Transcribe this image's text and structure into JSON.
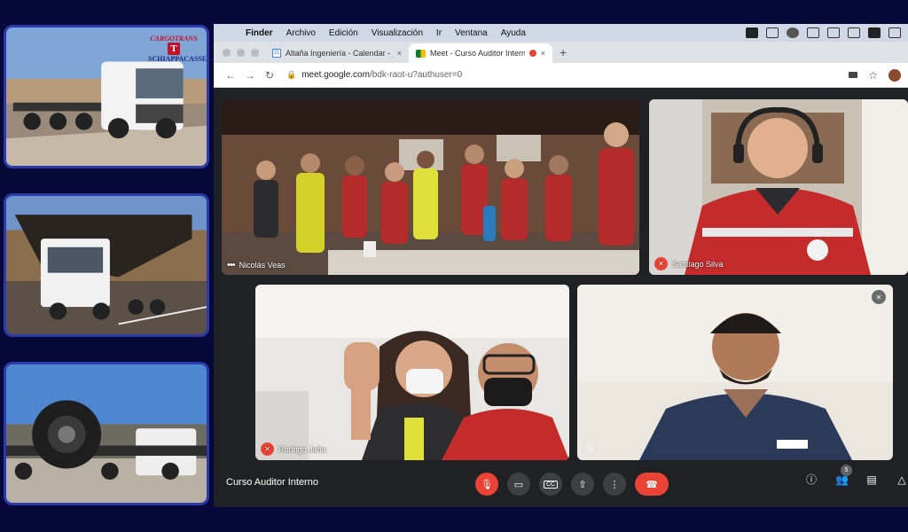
{
  "side_photos": {
    "logo": {
      "top": "CARGOTRANS",
      "mark": "T",
      "bottom": "SCHIAPPACASSE"
    },
    "items": [
      {
        "name": "flatbed-truck"
      },
      {
        "name": "mining-truck-bed-transport"
      },
      {
        "name": "giant-tire-transport"
      }
    ]
  },
  "menubar": {
    "apple": "",
    "items": [
      "Finder",
      "Archivo",
      "Edición",
      "Visualización",
      "Ir",
      "Ventana",
      "Ayuda"
    ]
  },
  "browser": {
    "tabs": [
      {
        "title": "Altaña Ingeniería - Calendar - j",
        "close": "×",
        "fav": "31"
      },
      {
        "title": "Meet - Curso Auditor Intern",
        "close": "×"
      }
    ],
    "new_tab": "+",
    "nav": {
      "back": "←",
      "forward": "→",
      "reload": "↻"
    },
    "lock": "🔒",
    "url_host": "meet.google.com",
    "url_path": "/bdk-raot-u?authuser=0",
    "star": "☆"
  },
  "meet": {
    "tiles": [
      {
        "name": "Nicolás Veas",
        "muted": false
      },
      {
        "name": "Santiago Silva",
        "muted": true
      },
      {
        "name": "Rodrigo Jaña",
        "muted": true
      },
      {
        "name": "",
        "muted": true,
        "corner_badge": "16"
      }
    ],
    "meeting_name": "Curso Auditor Interno",
    "controls": {
      "mic": "🎙",
      "camera": "▭",
      "captions": "CC",
      "present": "⇧",
      "more": "⋮",
      "end": "☎"
    },
    "right_controls": {
      "info": "ⓘ",
      "people": "👥",
      "people_count": "5",
      "chat": "▤",
      "activities": "△"
    }
  }
}
